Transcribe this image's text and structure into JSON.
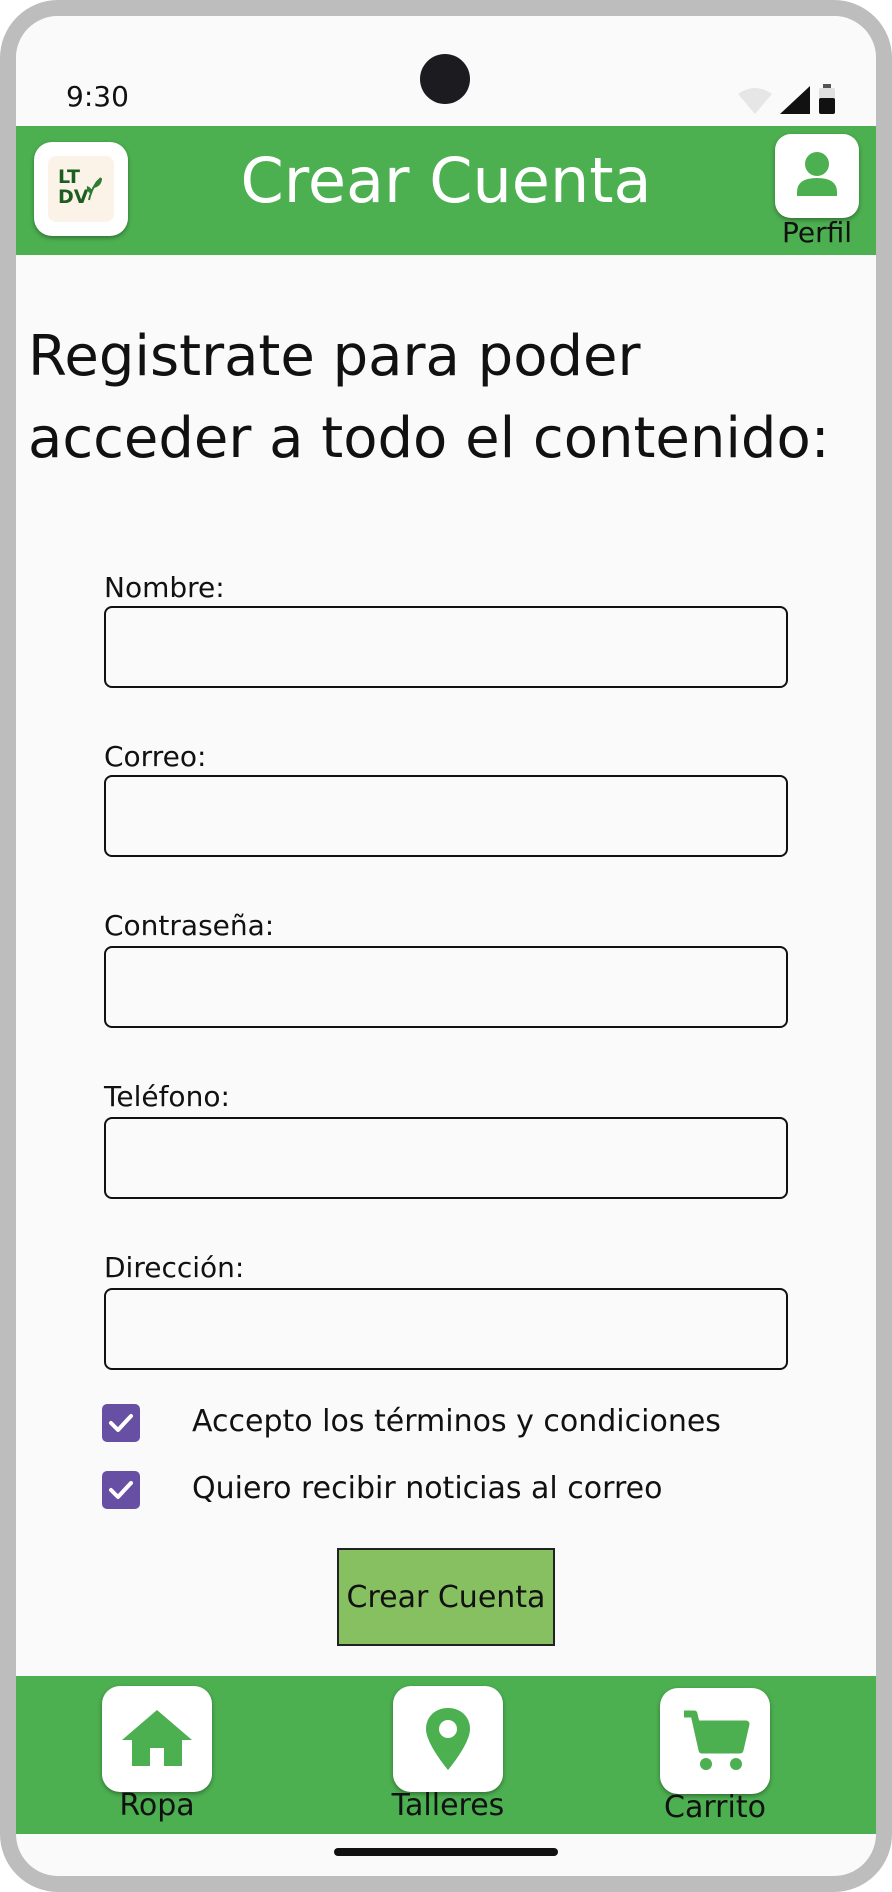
{
  "status_bar": {
    "time": "9:30",
    "icons": [
      "wifi-icon",
      "signal-icon",
      "battery-icon"
    ]
  },
  "app_bar": {
    "logo_text_line1": "LT",
    "logo_text_line2": "DV",
    "title": "Crear Cuenta",
    "profile_label": "Perfil",
    "background": "#4caf50"
  },
  "heading": "Registrate para poder acceder a todo el contenido:",
  "form": {
    "fields": [
      {
        "label": "Nombre:",
        "value": ""
      },
      {
        "label": "Correo:",
        "value": ""
      },
      {
        "label": "Contraseña:",
        "value": ""
      },
      {
        "label": "Teléfono:",
        "value": ""
      },
      {
        "label": "Dirección:",
        "value": ""
      }
    ],
    "checkboxes": [
      {
        "label": "Accepto los términos y condiciones",
        "checked": true
      },
      {
        "label": "Quiero recibir noticias al correo",
        "checked": true
      }
    ],
    "checkbox_color": "#6750a4",
    "submit_label": "Crear Cuenta",
    "submit_color": "#87c061"
  },
  "bottom_nav": {
    "items": [
      {
        "label": "Ropa",
        "icon": "home-icon"
      },
      {
        "label": "Talleres",
        "icon": "location-pin-icon"
      },
      {
        "label": "Carrito",
        "icon": "cart-icon"
      }
    ]
  }
}
